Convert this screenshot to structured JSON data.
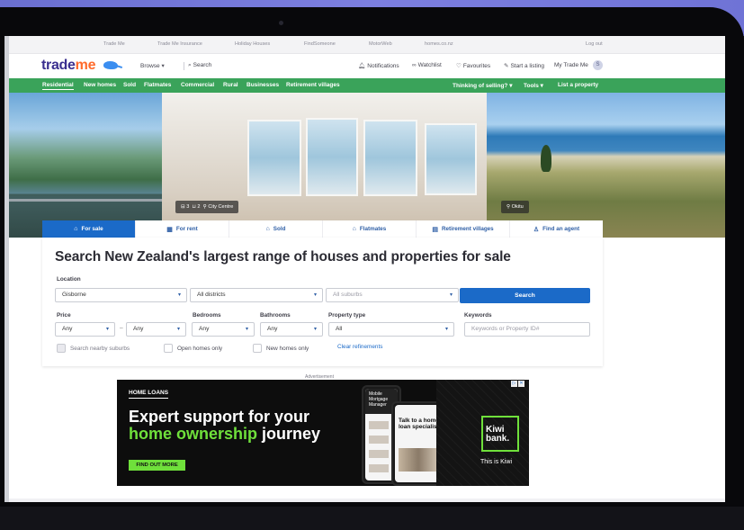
{
  "utility_links": [
    "Trade Me",
    "Trade Me Insurance",
    "Holiday Houses",
    "FindSomeone",
    "MotorWeb",
    "homes.co.nz"
  ],
  "logout": "Log out",
  "header": {
    "logo_trade": "trade",
    "logo_me": "me",
    "browse": "Browse",
    "search": "Search",
    "notifications": "Notifications",
    "watchlist": "Watchlist",
    "favourites": "Favourites",
    "start_listing": "Start a listing",
    "my_trademe": "My Trade Me",
    "avatar_initial": "S"
  },
  "greennav": {
    "items": [
      "Residential",
      "New homes",
      "Sold",
      "Flatmates",
      "Commercial",
      "Rural",
      "Businesses",
      "Retirement villages"
    ],
    "thinking": "Thinking of selling?",
    "tools": "Tools",
    "list_property": "List a property"
  },
  "hero": {
    "tag_mid": {
      "beds": "3",
      "baths": "2",
      "location": "City Centre"
    },
    "tag_right": "Okitu"
  },
  "tabs": [
    {
      "label": "For sale",
      "icon": "house-icon"
    },
    {
      "label": "For rent",
      "icon": "rent-icon"
    },
    {
      "label": "Sold",
      "icon": "sold-icon"
    },
    {
      "label": "Flatmates",
      "icon": "flatmates-icon"
    },
    {
      "label": "Retirement villages",
      "icon": "retirement-icon"
    },
    {
      "label": "Find an agent",
      "icon": "agent-icon"
    }
  ],
  "search": {
    "title": "Search New Zealand's largest range of houses and properties for sale",
    "location_label": "Location",
    "region": "Gisborne",
    "district": "All districts",
    "suburb": "All suburbs",
    "button": "Search",
    "price_label": "Price",
    "price_min": "Any",
    "price_max": "Any",
    "bedrooms_label": "Bedrooms",
    "bedrooms": "Any",
    "bathrooms_label": "Bathrooms",
    "bathrooms": "Any",
    "type_label": "Property type",
    "type": "All",
    "keywords_label": "Keywords",
    "keywords_placeholder": "Keywords or Property ID#",
    "nearby": "Search nearby suburbs",
    "open_homes": "Open homes only",
    "new_homes": "New homes only",
    "clear": "Clear refinements"
  },
  "ad": {
    "label": "Advertisement",
    "tag": "HOME LOANS",
    "line1": "Expert support for your",
    "line2_green": "home ownership",
    "line2_rest": " journey",
    "cta": "FIND OUT MORE",
    "brand_line1": "Kiwi",
    "brand_line2": "bank.",
    "brand_tagline": "This is Kiwi",
    "phone_headline": "Talk to a home loan specialist",
    "phone_dark": "Mobile Mortgage Manager"
  }
}
